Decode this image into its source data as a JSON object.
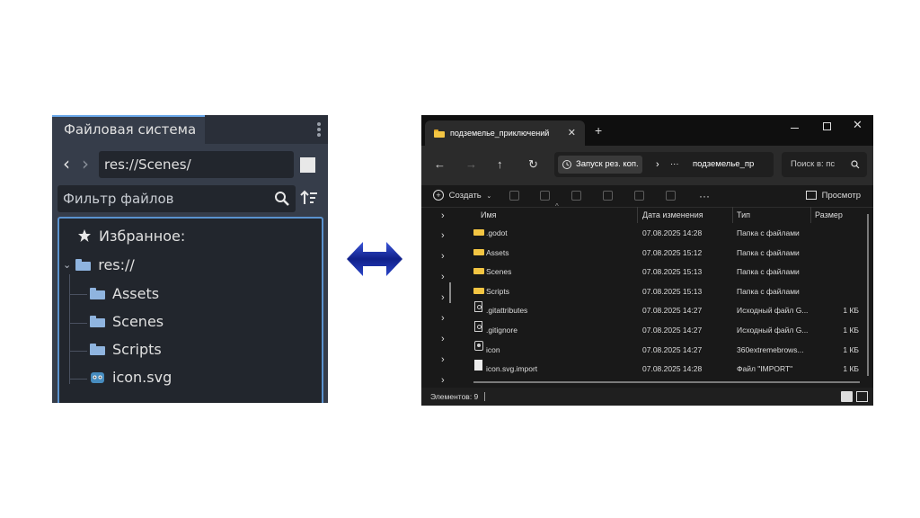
{
  "godot": {
    "tab_title": "Файловая система",
    "path": "res://Scenes/",
    "filter_placeholder": "Фильтр файлов",
    "favorites_label": "Избранное:",
    "root_label": "res://",
    "items": [
      {
        "name": "Assets",
        "icon": "folder-icon"
      },
      {
        "name": "Scenes",
        "icon": "folder-icon"
      },
      {
        "name": "Scripts",
        "icon": "folder-icon"
      },
      {
        "name": "icon.svg",
        "icon": "godot-logo-icon"
      }
    ],
    "colors": {
      "accent": "#68a6e8",
      "folder": "#8fb4df",
      "panel": "#363d4a"
    }
  },
  "arrow": {
    "icon": "double-arrow-icon",
    "color": "#1a2ea0"
  },
  "explorer": {
    "tab_title": "подземелье_приключений",
    "address_chip": "Запуск рез. коп.",
    "address_path": "подземелье_пр",
    "search_placeholder": "Поиск в: пс",
    "toolbar": {
      "new_label": "Создать",
      "preview_label": "Просмотр"
    },
    "columns": {
      "name": "Имя",
      "date": "Дата изменения",
      "type": "Тип",
      "size": "Размер"
    },
    "files": [
      {
        "name": ".godot",
        "date": "07.08.2025 14:28",
        "type": "Папка с файлами",
        "size": "",
        "icon": "folder"
      },
      {
        "name": "Assets",
        "date": "07.08.2025 15:12",
        "type": "Папка с файлами",
        "size": "",
        "icon": "folder"
      },
      {
        "name": "Scenes",
        "date": "07.08.2025 15:13",
        "type": "Папка с файлами",
        "size": "",
        "icon": "folder"
      },
      {
        "name": "Scripts",
        "date": "07.08.2025 15:13",
        "type": "Папка с файлами",
        "size": "",
        "icon": "folder"
      },
      {
        "name": ".gitattributes",
        "date": "07.08.2025 14:27",
        "type": "Исходный файл G...",
        "size": "1 КБ",
        "icon": "git"
      },
      {
        "name": ".gitignore",
        "date": "07.08.2025 14:27",
        "type": "Исходный файл G...",
        "size": "1 КБ",
        "icon": "git"
      },
      {
        "name": "icon",
        "date": "07.08.2025 14:27",
        "type": "360extremebrows...",
        "size": "1 КБ",
        "icon": "image"
      },
      {
        "name": "icon.svg.import",
        "date": "07.08.2025 14:28",
        "type": "Файл \"IMPORT\"",
        "size": "1 КБ",
        "icon": "file"
      }
    ],
    "status_text": "Элементов: 9",
    "colors": {
      "folder": "#f3c543",
      "background": "#191919"
    }
  }
}
